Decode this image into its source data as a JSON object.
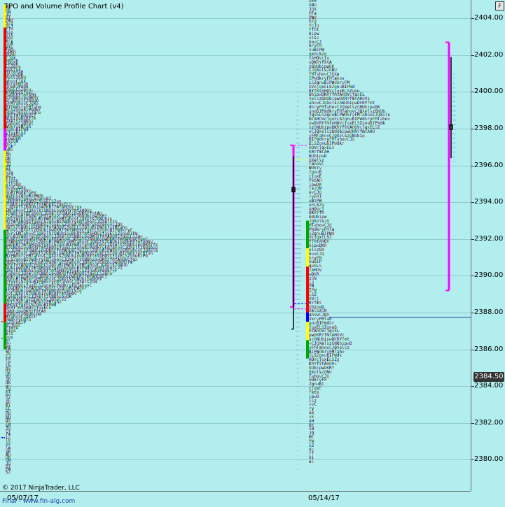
{
  "title": "TPO and Volume Profile Chart (v4)",
  "copyright": "© 2017 NinjaTrader, LLC",
  "url": "Final - www.fin-alg.com",
  "f_button": "F",
  "last_price_label": "2384.50",
  "colors": {
    "background": "#b3eeee",
    "poc_line": "#1f3fa8",
    "value_area": "#ff00ff",
    "letters": [
      "#000000",
      "#b22222",
      "#006400",
      "#00008b",
      "#8b4513",
      "#4b0082"
    ]
  },
  "chart_data": {
    "type": "table",
    "title": "TPO and Volume Profile Chart (v4)",
    "ylim": [
      2378.3,
      2405
    ],
    "y_ticks": [
      2380,
      2382,
      2384,
      2386,
      2388,
      2390,
      2392,
      2394,
      2396,
      2398,
      2400,
      2402,
      2404
    ],
    "y_tick_labels": [
      "2380.00",
      "2382.00",
      "2384.00",
      "2386.00",
      "2388.00",
      "2390.00",
      "2392.00",
      "2394.00",
      "2396.00",
      "2398.00",
      "2400.00",
      "2402.00",
      "2404.00"
    ],
    "x_dates": [
      "05/07/17",
      "05/14/17"
    ],
    "last_price": 2384.5,
    "poc_line_price": 2387.75,
    "profiles": [
      {
        "date": "05/07/17",
        "high": 2404.75,
        "low": 2379.25,
        "value_area_high": 2396.75,
        "value_area_low": 2388.25,
        "row_lengths": [
          2,
          2,
          2,
          2,
          2,
          3,
          3,
          3,
          3,
          3,
          3,
          3,
          3,
          3,
          3,
          3,
          4,
          4,
          4,
          5,
          5,
          6,
          6,
          7,
          7,
          8,
          8,
          9,
          9,
          10,
          11,
          12,
          13,
          13,
          13,
          14,
          14,
          14,
          12,
          12,
          11,
          11,
          10,
          9,
          8,
          7,
          6,
          5,
          4,
          3,
          3,
          2,
          2,
          2,
          2,
          2,
          2,
          2,
          3,
          3,
          4,
          5,
          6,
          8,
          10,
          12,
          15,
          18,
          22,
          26,
          30,
          34,
          38,
          40,
          42,
          44,
          46,
          48,
          50,
          52,
          54,
          56,
          58,
          60,
          60,
          60,
          58,
          56,
          52,
          50,
          48,
          46,
          44,
          42,
          40,
          38,
          36,
          34,
          32,
          30,
          28,
          26,
          24,
          22,
          20,
          18,
          16,
          14,
          12,
          10,
          8,
          6,
          5,
          4,
          3,
          3,
          2,
          2,
          2,
          2,
          2,
          2,
          2,
          2,
          2,
          2,
          2,
          2,
          2,
          2,
          2,
          2,
          2,
          2,
          2,
          2,
          2,
          2,
          2,
          2,
          2,
          2,
          2,
          2,
          2,
          2,
          2,
          2,
          2,
          2,
          2,
          2,
          2,
          2,
          2,
          2,
          2,
          2,
          2,
          2,
          2,
          2,
          2
        ]
      },
      {
        "date": "05/14/17",
        "high": 2405.25,
        "low": 2379.75,
        "value_area_high": 2402.75,
        "value_area_low": 2389.25,
        "row_lengths": [
          1,
          3,
          3,
          3,
          3,
          3,
          3,
          4,
          4,
          4,
          4,
          5,
          5,
          6,
          7,
          8,
          9,
          10,
          11,
          12,
          14,
          16,
          18,
          20,
          22,
          24,
          26,
          28,
          30,
          32,
          32,
          30,
          28,
          26,
          22,
          18,
          14,
          10,
          8,
          7,
          6,
          6,
          5,
          5,
          5,
          5,
          5,
          5,
          5,
          5,
          5,
          6,
          6,
          6,
          7,
          8,
          9,
          10,
          10,
          9,
          8,
          7,
          6,
          6,
          5,
          5,
          5,
          5,
          4,
          3,
          2,
          2,
          3,
          3,
          4,
          5,
          6,
          7,
          8,
          9,
          10,
          11,
          12,
          14,
          16,
          17,
          16,
          14,
          13,
          12,
          11,
          10,
          9,
          8,
          7,
          6,
          5,
          4,
          4,
          3,
          3,
          2,
          2,
          2,
          2,
          2,
          2,
          2,
          2,
          2,
          2,
          2,
          2,
          2,
          2
        ]
      }
    ]
  }
}
